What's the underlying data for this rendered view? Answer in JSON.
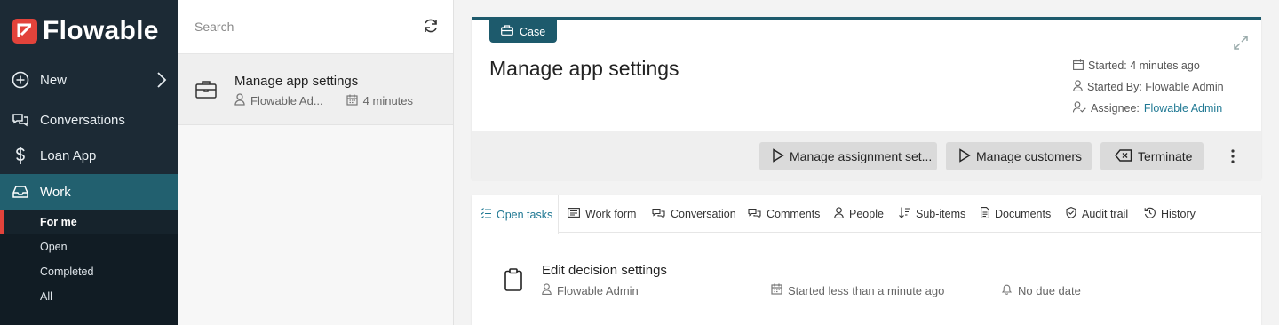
{
  "brand": {
    "name": "Flowable"
  },
  "sidebar": {
    "items": [
      {
        "label": "New",
        "icon": "plus-circle-icon"
      },
      {
        "label": "Conversations",
        "icon": "chat-bubbles-icon"
      },
      {
        "label": "Loan App",
        "icon": "dollar-icon"
      },
      {
        "label": "Work",
        "icon": "inbox-icon"
      }
    ],
    "sub_items": [
      {
        "label": "For me"
      },
      {
        "label": "Open"
      },
      {
        "label": "Completed"
      },
      {
        "label": "All"
      }
    ]
  },
  "list": {
    "search_placeholder": "Search",
    "items": [
      {
        "title": "Manage app settings",
        "owner": "Flowable Ad...",
        "age": "4 minutes"
      }
    ]
  },
  "case": {
    "tag": "Case",
    "title": "Manage app settings",
    "started": "Started: 4 minutes ago",
    "started_by": "Started By: Flowable Admin",
    "assignee_label": "Assignee:",
    "assignee": "Flowable Admin",
    "actions": [
      {
        "label": "Manage assignment set..."
      },
      {
        "label": "Manage customers"
      },
      {
        "label": "Terminate"
      }
    ]
  },
  "tabs": [
    {
      "label": "Open tasks",
      "icon": "checklist-icon"
    },
    {
      "label": "Work form",
      "icon": "form-icon"
    },
    {
      "label": "Conversation",
      "icon": "chat-icon"
    },
    {
      "label": "Comments",
      "icon": "comments-icon"
    },
    {
      "label": "People",
      "icon": "person-icon"
    },
    {
      "label": "Sub-items",
      "icon": "sort-icon"
    },
    {
      "label": "Documents",
      "icon": "document-icon"
    },
    {
      "label": "Audit trail",
      "icon": "shield-icon"
    },
    {
      "label": "History",
      "icon": "history-icon"
    }
  ],
  "task": {
    "title": "Edit decision settings",
    "assignee": "Flowable Admin",
    "started": "Started less than a minute ago",
    "due": "No due date"
  },
  "colors": {
    "sidebar": "#1c2a35",
    "accent": "#1d5a6c",
    "brand_red": "#e2433b",
    "link": "#1f7893"
  }
}
